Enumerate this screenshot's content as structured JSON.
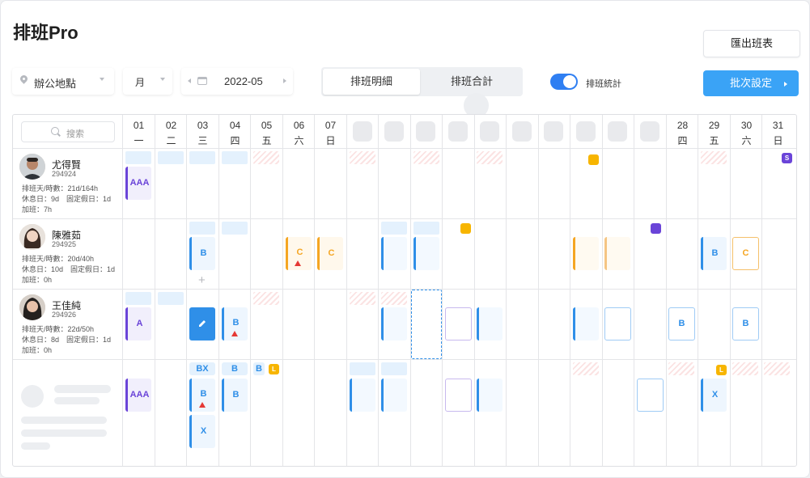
{
  "app": {
    "title": "排班Pro"
  },
  "toolbar": {
    "export_label": "匯出班表",
    "location_placeholder": "辦公地點",
    "period_unit": "月",
    "month_value": "2022-05",
    "tabs": [
      {
        "label": "排班明細",
        "active": true
      },
      {
        "label": "排班合計",
        "active": false
      }
    ],
    "stats_toggle_label": "排班統計",
    "stats_toggle_on": true,
    "batch_label": "批次設定"
  },
  "grid": {
    "search_placeholder": "搜索",
    "visible_days": [
      {
        "num": "01",
        "wd": "一"
      },
      {
        "num": "02",
        "wd": "二"
      },
      {
        "num": "03",
        "wd": "三"
      },
      {
        "num": "04",
        "wd": "四"
      },
      {
        "num": "05",
        "wd": "五"
      },
      {
        "num": "06",
        "wd": "六"
      },
      {
        "num": "07",
        "wd": "日"
      },
      {
        "num": "28",
        "wd": "四"
      },
      {
        "num": "29",
        "wd": "五"
      },
      {
        "num": "30",
        "wd": "六"
      },
      {
        "num": "31",
        "wd": "日"
      }
    ],
    "employees": [
      {
        "name": "尤得賢",
        "id": "294924",
        "line1": "排班天/時數：21d/164h",
        "line2": "休息日：9d　固定假日：1d",
        "line3": "加班：7h"
      },
      {
        "name": "陳雅茹",
        "id": "294925",
        "line1": "排班天/時數：20d/40h",
        "line2": "休息日：10d　固定假日：1d",
        "line3": "加班：0h"
      },
      {
        "name": "王佳純",
        "id": "294926",
        "line1": "排班天/時數：22d/50h",
        "line2": "休息日：8d　固定假日：1d",
        "line3": "加班：0h"
      }
    ],
    "shift_labels": {
      "aaa": "AAA",
      "a": "A",
      "b": "B",
      "c": "C",
      "x": "X",
      "bx": "BX",
      "s": "S",
      "l": "L"
    }
  },
  "colors": {
    "primary": "#3aa3f6",
    "toggle": "#2f7ff2",
    "purple": "#6a44d8",
    "orange": "#f5a623",
    "yellow": "#f7b500",
    "blue": "#2f8fe8",
    "warning": "#e53935"
  },
  "icons": {
    "location": "location-pin-icon",
    "calendar": "calendar-icon",
    "search": "search-icon",
    "edit": "pencil-icon",
    "warning": "warning-triangle-icon",
    "add": "plus-icon"
  }
}
